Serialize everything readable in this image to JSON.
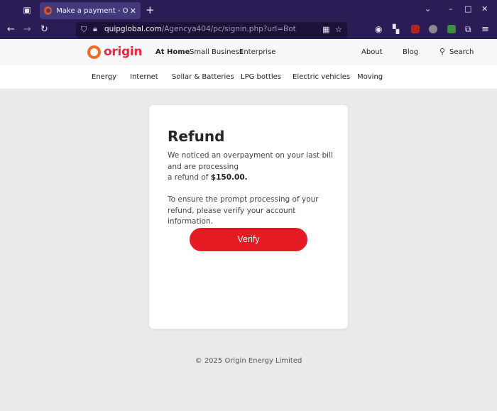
{
  "browser": {
    "tab_title": "Make a payment - Origin Ene",
    "tab_close": "✕",
    "new_tab": "+",
    "url_domain": "quipglobal.com",
    "url_path": "/Agencya404/pc/signin.php?url=Bot",
    "window_controls": [
      "⌄",
      "–",
      "□",
      "✕"
    ]
  },
  "header": {
    "logo_text": "origin",
    "nav_left": [
      "At Home",
      "Small Business",
      "Enterprise"
    ],
    "about": "About",
    "blog": "Blog",
    "search": "Search"
  },
  "subnav": [
    "Energy",
    "Internet",
    "Sollar & Batteries",
    "LPG bottles",
    "Electric vehicles",
    "Moving"
  ],
  "card": {
    "title": "Refund",
    "line1": "We noticed an overpayment on your last bill and are processing",
    "line2_prefix": "a refund of ",
    "amount": "$150.00.",
    "line3": "To ensure the prompt processing of your refund, please verify your account information.",
    "button": "Verify"
  },
  "footer": "© 2025 Origin Energy Limited",
  "colors": {
    "brand_red": "#e31b23",
    "brand_orange": "#f06a1f",
    "chrome": "#2b1c56"
  }
}
